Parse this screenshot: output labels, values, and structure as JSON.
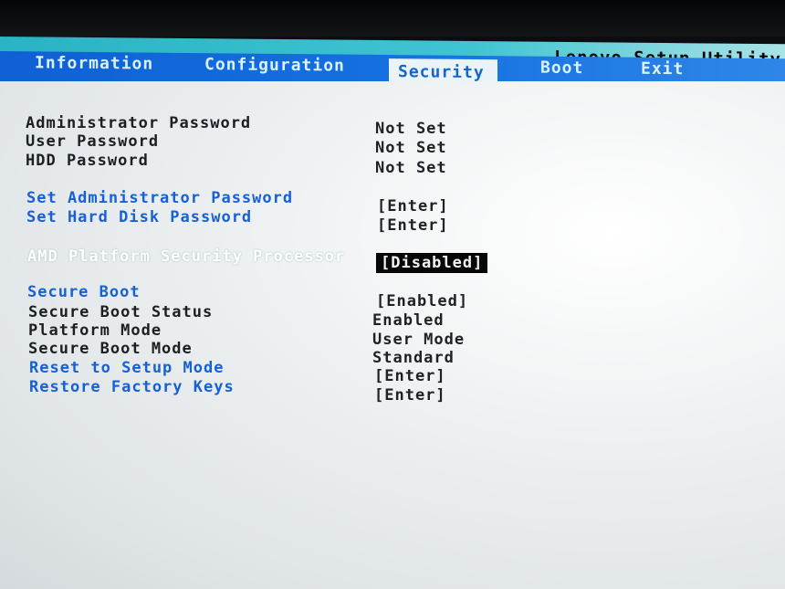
{
  "header": {
    "app_title": "Lenovo Setup Utility"
  },
  "menu": {
    "tabs": [
      {
        "label": "Information"
      },
      {
        "label": "Configuration"
      },
      {
        "label": "Security"
      },
      {
        "label": "Boot"
      },
      {
        "label": "Exit"
      }
    ],
    "active_tab": "Security"
  },
  "security": {
    "admin_password_label": "Administrator Password",
    "admin_password_value": "Not Set",
    "user_password_label": "User Password",
    "user_password_value": "Not Set",
    "hdd_password_label": "HDD Password",
    "hdd_password_value": "Not Set",
    "set_admin_password_label": "Set Administrator Password",
    "set_admin_password_value": "[Enter]",
    "set_hdd_password_label": "Set Hard Disk Password",
    "set_hdd_password_value": "[Enter]",
    "amd_psp_label": "AMD Platform Security Processor",
    "amd_psp_value": "[Disabled]",
    "secure_boot_label": "Secure Boot",
    "secure_boot_value": "[Enabled]",
    "secure_boot_status_label": "Secure Boot Status",
    "secure_boot_status_value": "Enabled",
    "platform_mode_label": "Platform Mode",
    "platform_mode_value": "User Mode",
    "secure_boot_mode_label": "Secure Boot Mode",
    "secure_boot_mode_value": "Standard",
    "reset_setup_mode_label": "Reset to Setup Mode",
    "reset_setup_mode_value": "[Enter]",
    "restore_factory_keys_label": "Restore Factory Keys",
    "restore_factory_keys_value": "[Enter]"
  },
  "colors": {
    "title_bar": "#2ab3c4",
    "menu_bar": "#1570e0",
    "link_text": "#1660d8",
    "content_bg": "#eef1f2",
    "selection_bg": "#060606"
  }
}
